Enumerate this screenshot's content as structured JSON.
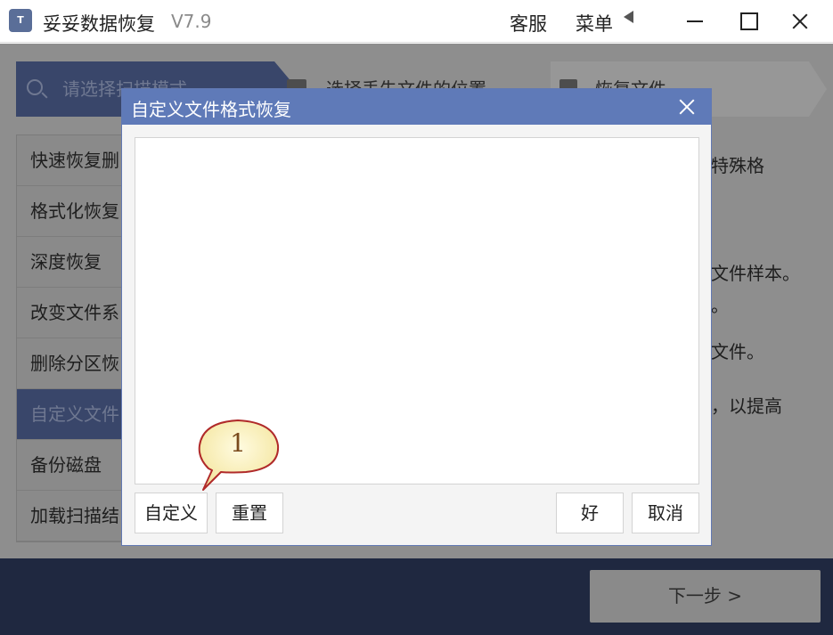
{
  "titlebar": {
    "logo_text": "T",
    "app_name": "妥妥数据恢复",
    "version": "V7.9",
    "service": "客服",
    "menu": "菜单"
  },
  "steps": [
    "请选择扫描模式",
    "选择丢失文件的位置",
    "恢复文件"
  ],
  "modes": [
    "快速恢复删",
    "格式化恢复",
    "深度恢复",
    "改变文件系",
    "删除分区恢",
    "自定义文件",
    "备份磁盘",
    "加载扫描结"
  ],
  "description_fragments": [
    "特殊格",
    "文件样本。",
    "。",
    "文件。",
    "，以提高"
  ],
  "bottom": {
    "next_label": "下一步 >"
  },
  "dialog": {
    "title": "自定义文件格式恢复",
    "custom_label": "自定义",
    "reset_label": "重置",
    "ok_label": "好",
    "cancel_label": "取消"
  },
  "callout": {
    "number": "1"
  }
}
